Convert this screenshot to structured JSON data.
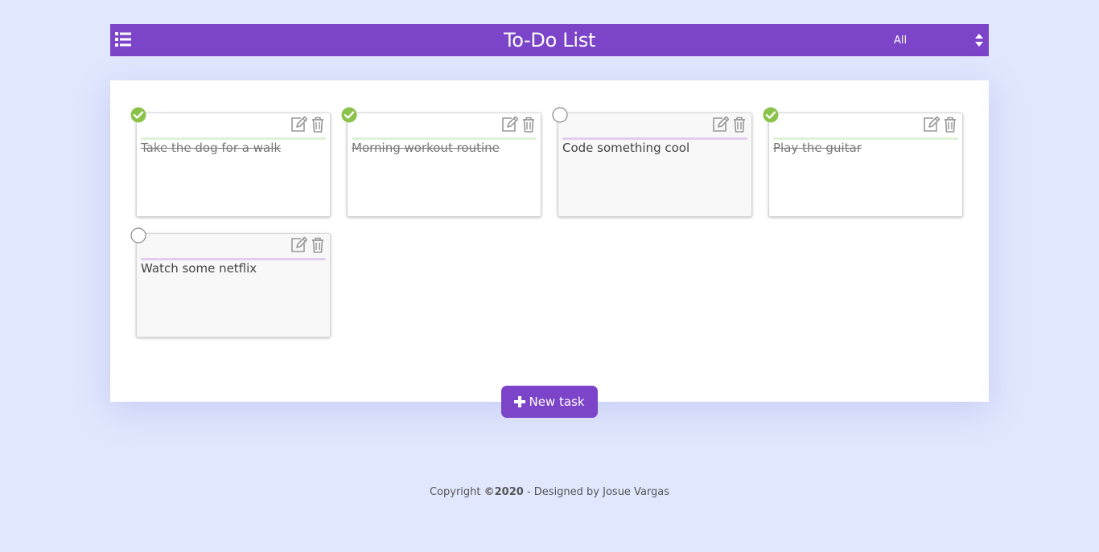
{
  "header": {
    "title": "To-Do List",
    "filter_value": "All"
  },
  "tasks": [
    {
      "text": "Take the dog for a walk",
      "done": true
    },
    {
      "text": "Morning workout routine",
      "done": true
    },
    {
      "text": "Code something cool",
      "done": false
    },
    {
      "text": "Play the guitar",
      "done": true
    },
    {
      "text": "Watch some netflix",
      "done": false
    }
  ],
  "new_task_label": "New task",
  "footer": {
    "prefix": "Copyright ",
    "year": "©2020",
    "suffix": " - Designed by Josue Vargas"
  },
  "colors": {
    "accent": "#7c44c8",
    "background": "#e1e7fd",
    "done_check": "#8bc34a"
  }
}
